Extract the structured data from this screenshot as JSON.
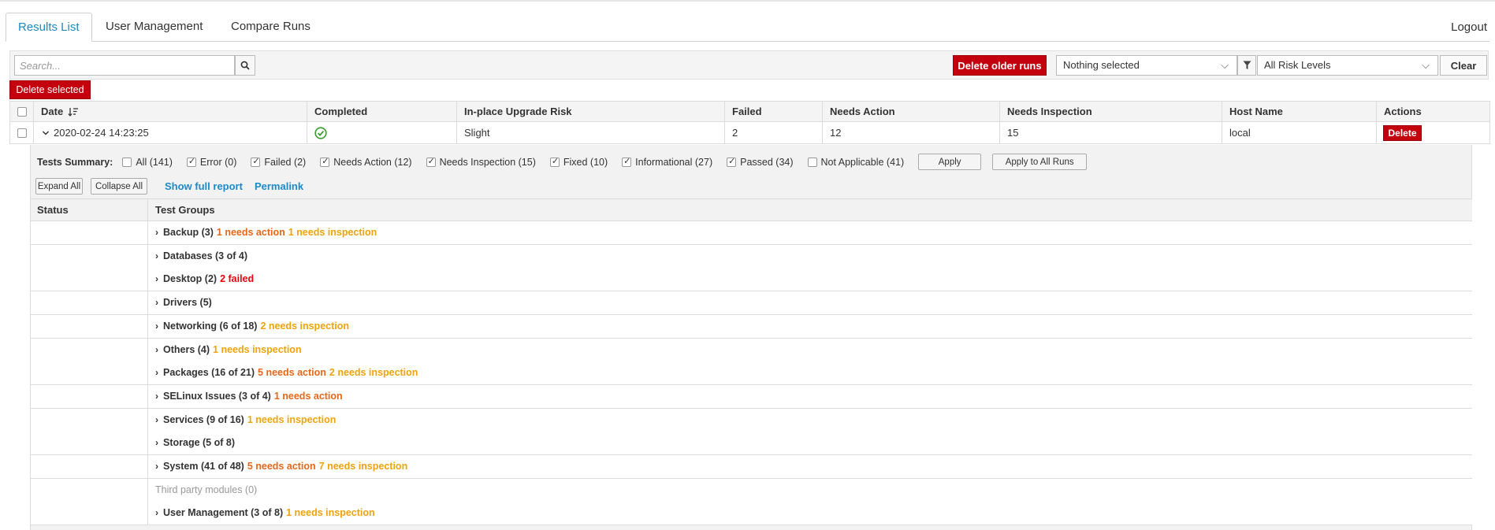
{
  "tabs": [
    {
      "label": "Results List",
      "active": true
    },
    {
      "label": "User Management",
      "active": false
    },
    {
      "label": "Compare Runs",
      "active": false
    }
  ],
  "logout_label": "Logout",
  "toolbar": {
    "search_placeholder": "Search...",
    "delete_older_label": "Delete older runs",
    "selection_value": "Nothing selected",
    "risk_value": "All Risk Levels",
    "clear_label": "Clear"
  },
  "delete_selected_label": "Delete selected",
  "table": {
    "headers": [
      "Date",
      "Completed",
      "In-place Upgrade Risk",
      "Failed",
      "Needs Action",
      "Needs Inspection",
      "Host Name",
      "Actions"
    ],
    "row": {
      "date": "2020-02-24 14:23:25",
      "risk": "Slight",
      "failed": "2",
      "needs_action": "12",
      "needs_inspection": "15",
      "host": "local",
      "action_label": "Delete"
    }
  },
  "details": {
    "summary_label": "Tests Summary:",
    "filters": [
      {
        "label": "All (141)",
        "checked": false
      },
      {
        "label": "Error (0)",
        "checked": true
      },
      {
        "label": "Failed (2)",
        "checked": true
      },
      {
        "label": "Needs Action (12)",
        "checked": true
      },
      {
        "label": "Needs Inspection (15)",
        "checked": true
      },
      {
        "label": "Fixed (10)",
        "checked": true
      },
      {
        "label": "Informational (27)",
        "checked": true
      },
      {
        "label": "Passed (34)",
        "checked": true
      },
      {
        "label": "Not Applicable (41)",
        "checked": false
      }
    ],
    "apply_label": "Apply",
    "apply_all_label": "Apply to All Runs",
    "expand_label": "Expand All",
    "collapse_label": "Collapse All",
    "full_report_label": "Show full report",
    "permalink_label": "Permalink",
    "group_headers": {
      "status": "Status",
      "groups": "Test Groups"
    },
    "groups": [
      {
        "name": "Backup (3)",
        "tags": [
          {
            "text": "1 needs action",
            "kind": "needs-action"
          },
          {
            "text": "1 needs inspection",
            "kind": "needs-insp"
          }
        ]
      },
      {
        "name": "Databases (3 of 4)",
        "tags": []
      },
      {
        "name": "Desktop (2)",
        "tags": [
          {
            "text": "2 failed",
            "kind": "failed"
          }
        ]
      },
      {
        "name": "Drivers (5)",
        "tags": []
      },
      {
        "name": "Networking (6 of 18)",
        "tags": [
          {
            "text": "2 needs inspection",
            "kind": "needs-insp"
          }
        ]
      },
      {
        "name": "Others (4)",
        "tags": [
          {
            "text": "1 needs inspection",
            "kind": "needs-insp"
          }
        ]
      },
      {
        "name": "Packages (16 of 21)",
        "tags": [
          {
            "text": "5 needs action",
            "kind": "needs-action"
          },
          {
            "text": "2 needs inspection",
            "kind": "needs-insp"
          }
        ]
      },
      {
        "name": "SELinux Issues (3 of 4)",
        "tags": [
          {
            "text": "1 needs action",
            "kind": "needs-action"
          }
        ]
      },
      {
        "name": "Services (9 of 16)",
        "tags": [
          {
            "text": "1 needs inspection",
            "kind": "needs-insp"
          }
        ]
      },
      {
        "name": "Storage (5 of 8)",
        "tags": []
      },
      {
        "name": "System (41 of 48)",
        "tags": [
          {
            "text": "5 needs action",
            "kind": "needs-action"
          },
          {
            "text": "7 needs inspection",
            "kind": "needs-insp"
          }
        ]
      },
      {
        "name": "Third party modules (0)",
        "tags": [],
        "muted": true
      },
      {
        "name": "User Management (3 of 8)",
        "tags": [
          {
            "text": "1 needs inspection",
            "kind": "needs-insp"
          }
        ]
      }
    ]
  },
  "colors": {
    "accent": "#1c8ac9",
    "danger": "#c4000e",
    "needs_action": "#e8671a",
    "needs_inspection": "#f0a30a",
    "failed": "#e8000b",
    "ok": "#3a9a2e"
  }
}
